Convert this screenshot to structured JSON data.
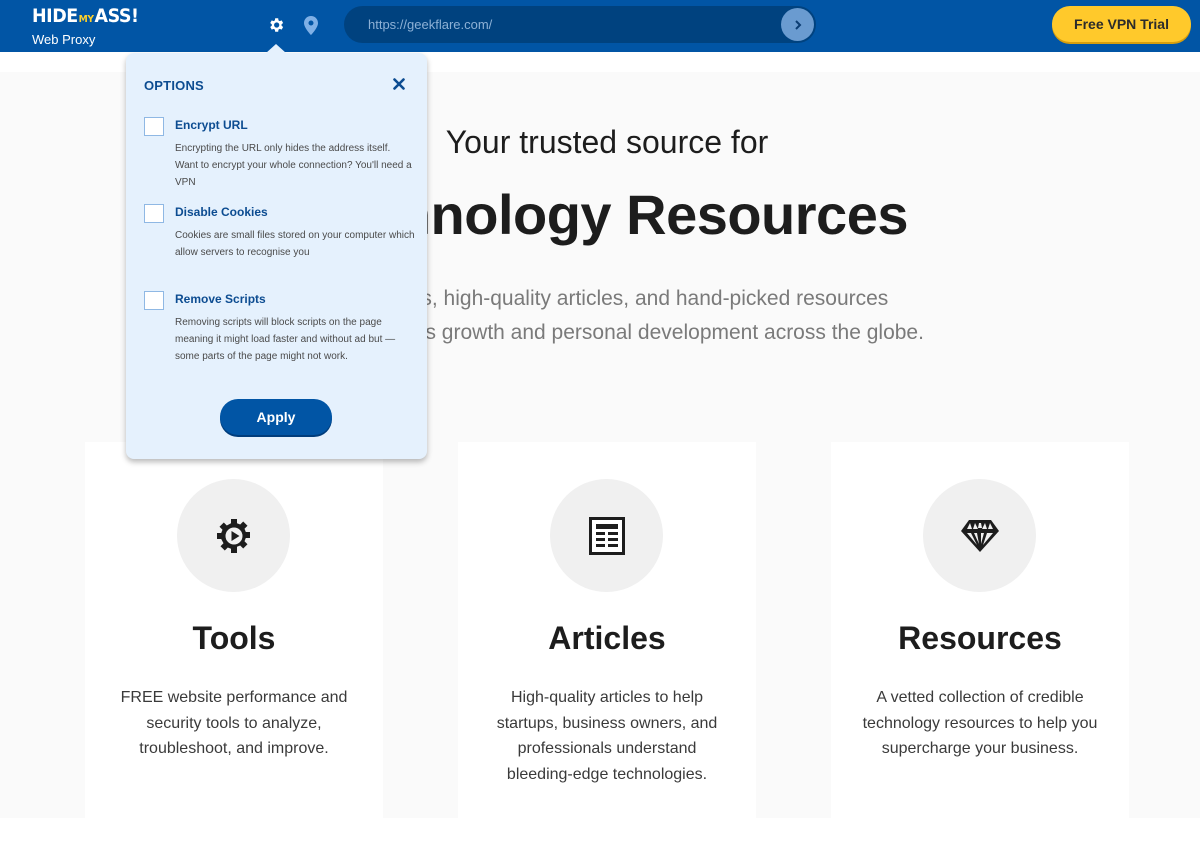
{
  "topbar": {
    "logo": {
      "part1": "HIDE",
      "part2": "MY",
      "part3": "ASS!",
      "subtitle": "Web Proxy"
    },
    "icons": {
      "settings": "gear-icon",
      "location": "map-pin-icon",
      "go": "chevron-right-icon"
    },
    "url_input": {
      "value": "https://geekflare.com/",
      "placeholder": ""
    },
    "vpn_button": "Free VPN Trial"
  },
  "options_popup": {
    "title": "OPTIONS",
    "close_icon": "close-icon",
    "options": [
      {
        "label": "Encrypt URL",
        "checked": false,
        "description": "Encrypting the URL only hides the address itself. Want to encrypt your whole connection? You'll need a VPN"
      },
      {
        "label": "Disable Cookies",
        "checked": false,
        "description": "Cookies are small files stored on your computer which allow servers to recognise you"
      },
      {
        "label": "Remove Scripts",
        "checked": false,
        "description": "Removing scripts will block scripts on the page meaning it might load faster and without ad but — some parts of the page might not work."
      }
    ],
    "apply_label": "Apply"
  },
  "page": {
    "hero": {
      "kicker": "Your trusted source for",
      "title": "Technology Resources",
      "description_line1": "FREE tools, high-quality articles, and hand-picked resources",
      "description_line2": "to fuel business growth and personal development across the globe."
    },
    "cards": [
      {
        "icon": "gear-play-icon",
        "title": "Tools",
        "text": "FREE website performance and security tools to analyze, troubleshoot, and improve."
      },
      {
        "icon": "article-icon",
        "title": "Articles",
        "text": "High-quality articles to help startups, business owners, and professionals understand bleeding-edge technologies."
      },
      {
        "icon": "diamond-icon",
        "title": "Resources",
        "text": "A vetted collection of credible technology resources to help you supercharge your business."
      }
    ]
  },
  "colors": {
    "topbar": "#0155a5",
    "urlbar": "#00427f",
    "vpn_button": "#ffc92b",
    "popup_bg": "#e5f1fd",
    "popup_accent": "#0c4c91"
  }
}
